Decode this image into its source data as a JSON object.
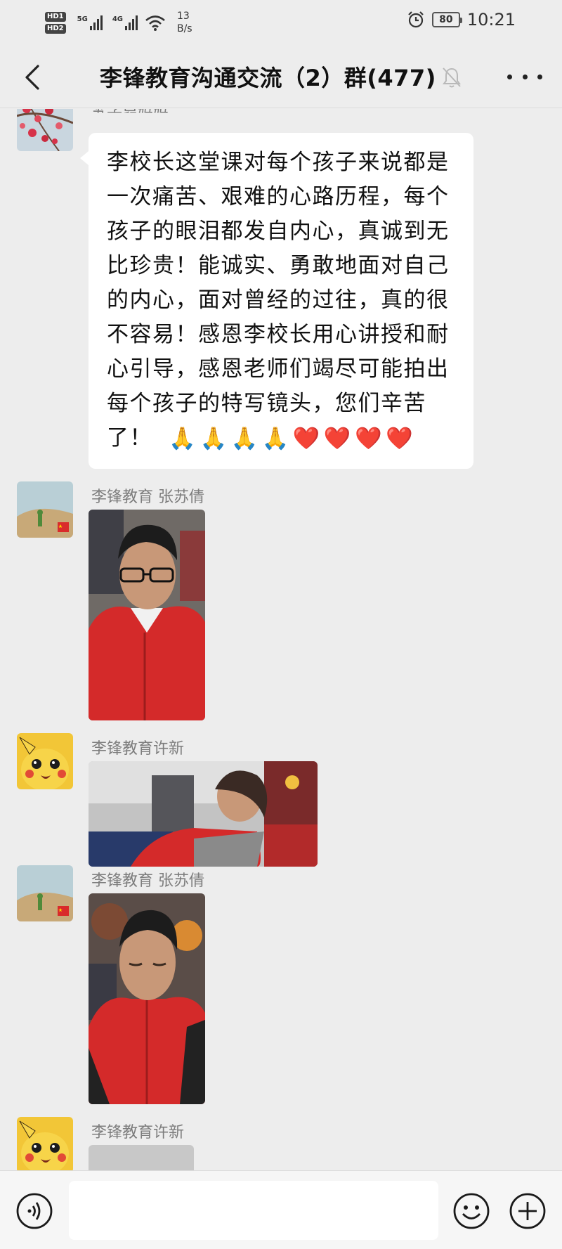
{
  "status_bar": {
    "hd1": "HD1",
    "hd2": "HD2",
    "sig1_label": "5G",
    "sig2_label": "4G",
    "net_speed_value": "13",
    "net_speed_unit": "B/s",
    "battery": "80",
    "time": "10:21"
  },
  "header": {
    "title": "李锋教育沟通交流（2）群(477)"
  },
  "messages": [
    {
      "sender": "苏子昂妈妈",
      "text": "李校长这堂课对每个孩子来说都是一次痛苦、艰难的心路历程，每个孩子的眼泪都发自内心，真诚到无比珍贵！能诚实、勇敢地面对自己的内心，面对曾经的过往，真的很不容易！感恩李校长用心讲授和耐心引导，感恩老师们竭尽可能拍出每个孩子的特写镜头，您们辛苦了！",
      "emojis": [
        "🙏",
        "🙏",
        "🙏",
        "🙏",
        "❤️",
        "❤️",
        "❤️",
        "❤️"
      ]
    },
    {
      "sender": "李锋教育  张苏倩"
    },
    {
      "sender": "李锋教育许新"
    },
    {
      "sender": "李锋教育  张苏倩"
    },
    {
      "sender": "李锋教育许新"
    }
  ],
  "input": {
    "placeholder": ""
  },
  "icons": {
    "back": "back-arrow-icon",
    "mute": "bell-muted-icon",
    "more": "more-dots-icon",
    "voice": "voice-icon",
    "emoji": "emoji-icon",
    "plus": "plus-icon"
  },
  "colors": {
    "background": "#ededed",
    "bubble": "#ffffff",
    "jacket_red": "#d42a2a"
  }
}
